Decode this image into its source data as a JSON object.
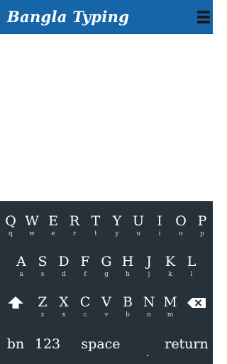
{
  "app": {
    "title": "Bangla Typing",
    "header_color": "#1565a8"
  },
  "header": {
    "menu_icon": "hamburger-menu-icon"
  },
  "keyboard": {
    "background": "#27313a",
    "rows": [
      [
        {
          "main": "Q",
          "sub": "q"
        },
        {
          "main": "W",
          "sub": "w"
        },
        {
          "main": "E",
          "sub": "e"
        },
        {
          "main": "R",
          "sub": "r"
        },
        {
          "main": "T",
          "sub": "t"
        },
        {
          "main": "Y",
          "sub": "y"
        },
        {
          "main": "U",
          "sub": "u"
        },
        {
          "main": "I",
          "sub": "i"
        },
        {
          "main": "O",
          "sub": "o"
        },
        {
          "main": "P",
          "sub": "p"
        }
      ],
      [
        {
          "main": "A",
          "sub": "a"
        },
        {
          "main": "S",
          "sub": "s"
        },
        {
          "main": "D",
          "sub": "d"
        },
        {
          "main": "F",
          "sub": "f"
        },
        {
          "main": "G",
          "sub": "g"
        },
        {
          "main": "H",
          "sub": "h"
        },
        {
          "main": "J",
          "sub": "j"
        },
        {
          "main": "K",
          "sub": "k"
        },
        {
          "main": "L",
          "sub": "l"
        }
      ],
      [
        {
          "main": "Z",
          "sub": "z"
        },
        {
          "main": "X",
          "sub": "x"
        },
        {
          "main": "C",
          "sub": "c"
        },
        {
          "main": "V",
          "sub": "v"
        },
        {
          "main": "B",
          "sub": "b"
        },
        {
          "main": "N",
          "sub": "n"
        },
        {
          "main": "M",
          "sub": "m"
        }
      ]
    ],
    "shift_icon": "shift-arrow-icon",
    "backspace_icon": "backspace-icon",
    "bottom": {
      "lang": "bn",
      "numbers": "123",
      "space": "space",
      "period": ".",
      "return": "return"
    }
  }
}
